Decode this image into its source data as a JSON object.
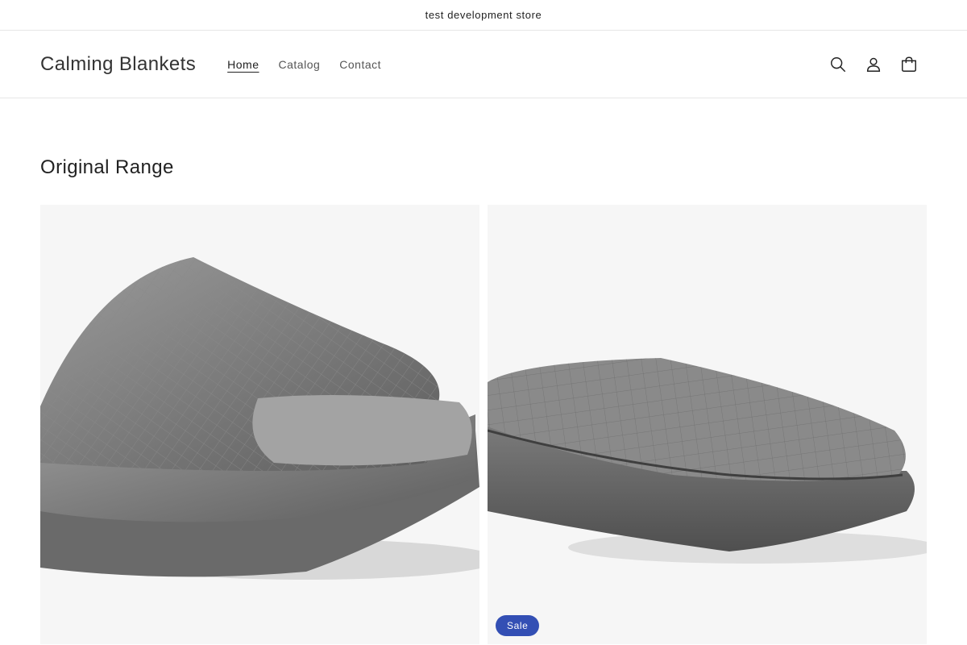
{
  "announcement": {
    "text": "test development store"
  },
  "header": {
    "logo": "Calming Blankets",
    "nav": [
      {
        "label": "Home",
        "active": true
      },
      {
        "label": "Catalog",
        "active": false
      },
      {
        "label": "Contact",
        "active": false
      }
    ],
    "icons": [
      "search-icon",
      "account-icon",
      "cart-icon"
    ]
  },
  "section": {
    "title": "Original Range",
    "products": [
      {
        "image": "folded-quilted-velvet-blanket",
        "badge": ""
      },
      {
        "image": "folded-quilted-grey-blanket",
        "badge": "Sale"
      }
    ]
  },
  "colors": {
    "badge": "#334fb4",
    "card_bg": "#f6f6f6"
  }
}
